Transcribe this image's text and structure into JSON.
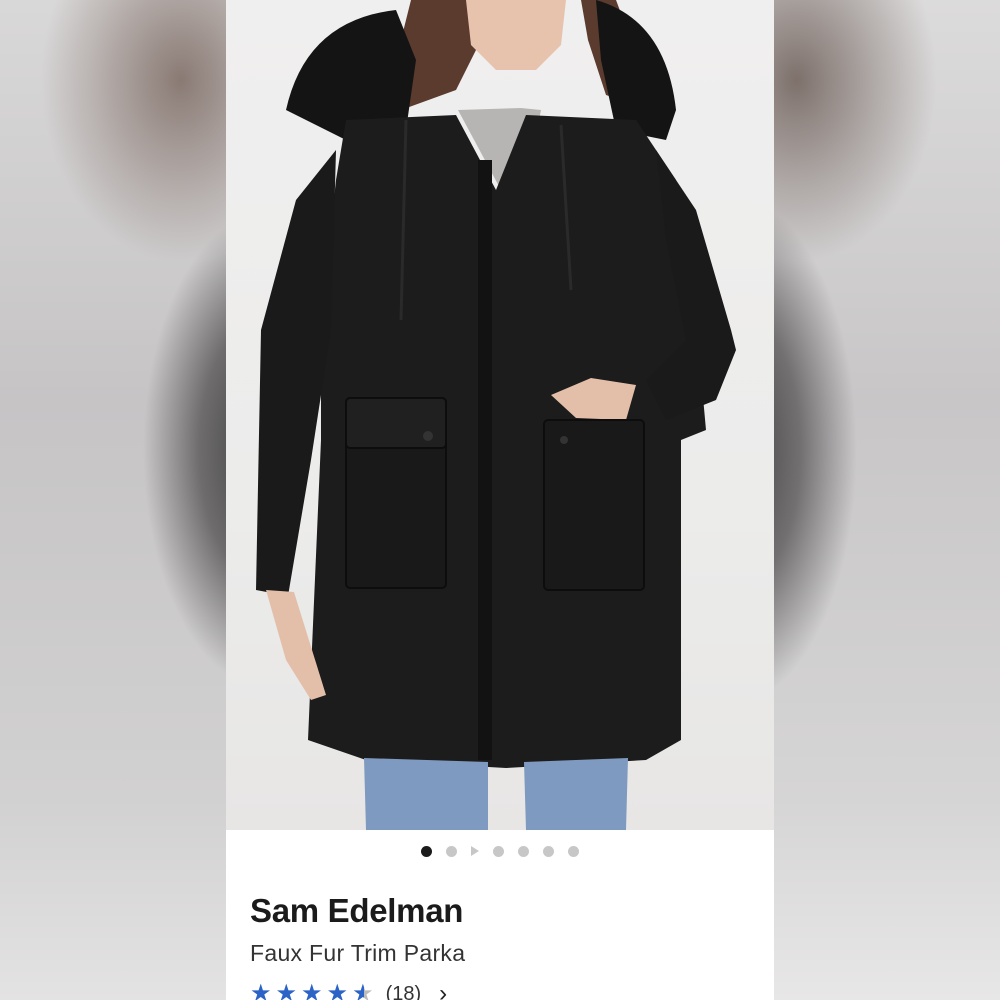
{
  "carousel": {
    "dots": [
      "active",
      "inactive",
      "video",
      "inactive",
      "inactive",
      "inactive",
      "inactive"
    ]
  },
  "product": {
    "brand": "Sam Edelman",
    "name": "Faux Fur Trim Parka",
    "rating_stars": 4.5,
    "review_count": "(18)"
  },
  "icons": {
    "chevron": "chevron-right-icon",
    "star": "star-icon"
  },
  "colors": {
    "accent_star": "#2b63c6",
    "text": "#1b1b1b"
  }
}
